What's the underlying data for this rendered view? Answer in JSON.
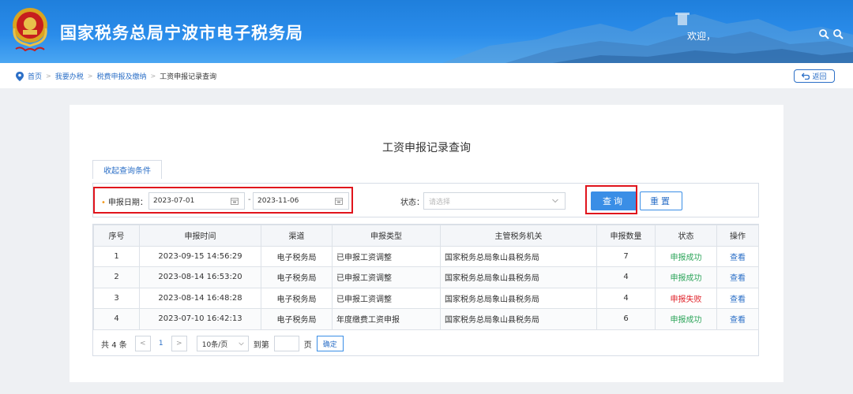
{
  "header": {
    "title": "国家税务总局宁波市电子税务局",
    "welcome": "欢迎，",
    "zoom_icons": [
      "zoom-in-icon",
      "zoom-out-icon"
    ]
  },
  "breadcrumb": {
    "items": [
      "首页",
      "我要办税",
      "税费申报及缴纳",
      "工资申报记录查询"
    ],
    "back_label": "返回"
  },
  "page": {
    "title": "工资申报记录查询",
    "tab_label": "收起查询条件"
  },
  "query": {
    "date_label": "申报日期：",
    "date_start": "2023-07-01",
    "date_end": "2023-11-06",
    "dash": "-",
    "status_label": "状态：",
    "status_placeholder": "请选择",
    "query_button": "查询",
    "reset_button": "重置"
  },
  "table": {
    "headers": [
      "序号",
      "申报时间",
      "渠道",
      "申报类型",
      "主管税务机关",
      "申报数量",
      "状态",
      "操作"
    ],
    "rows": [
      {
        "no": "1",
        "time": "2023-09-15 14:56:29",
        "channel": "电子税务局",
        "type": "已申报工资调整",
        "office": "国家税务总局象山县税务局",
        "count": "7",
        "status": "申报成功",
        "action": "查看"
      },
      {
        "no": "2",
        "time": "2023-08-14 16:53:20",
        "channel": "电子税务局",
        "type": "已申报工资调整",
        "office": "国家税务总局象山县税务局",
        "count": "4",
        "status": "申报成功",
        "action": "查看"
      },
      {
        "no": "3",
        "time": "2023-08-14 16:48:28",
        "channel": "电子税务局",
        "type": "已申报工资调整",
        "office": "国家税务总局象山县税务局",
        "count": "4",
        "status": "申报失败",
        "action": "查看"
      },
      {
        "no": "4",
        "time": "2023-07-10 16:42:13",
        "channel": "电子税务局",
        "type": "年度缴费工资申报",
        "office": "国家税务总局象山县税务局",
        "count": "6",
        "status": "申报成功",
        "action": "查看"
      }
    ]
  },
  "pager": {
    "total_prefix": "共",
    "total": "4",
    "total_suffix": "条",
    "prev": "<",
    "current_page": "1",
    "next": ">",
    "page_size": "10条/页",
    "goto_label": "到第",
    "page_unit": "页",
    "confirm": "确定"
  },
  "colors": {
    "header_blue": "#2a8cea",
    "accent": "#3a8ee6",
    "success": "#2ea55b",
    "fail": "#e0232b",
    "highlight_box": "#e0141c"
  }
}
